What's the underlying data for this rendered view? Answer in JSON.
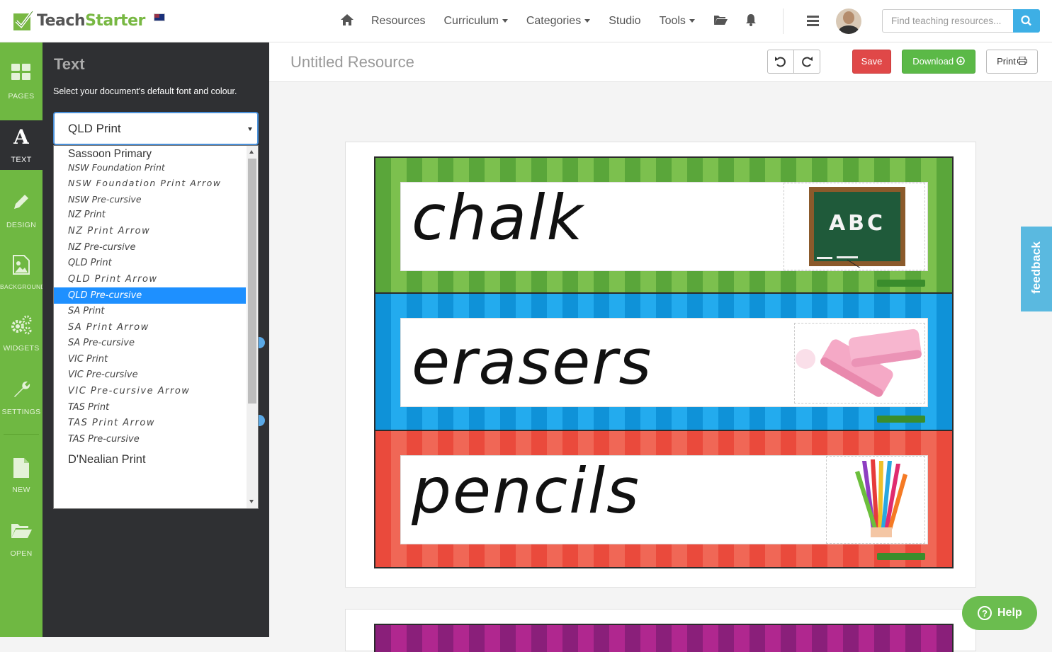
{
  "header": {
    "brand_part1": "Teach",
    "brand_part2": "Starter",
    "nav": [
      {
        "label": "Resources",
        "dropdown": false
      },
      {
        "label": "Curriculum",
        "dropdown": true
      },
      {
        "label": "Categories",
        "dropdown": true
      },
      {
        "label": "Studio",
        "dropdown": false
      },
      {
        "label": "Tools",
        "dropdown": true
      }
    ],
    "search_placeholder": "Find teaching resources..."
  },
  "sidebar": {
    "items": [
      {
        "label": "PAGES",
        "icon": "grid-icon"
      },
      {
        "label": "TEXT",
        "icon": "font-a-icon",
        "active": true
      },
      {
        "label": "DESIGN",
        "icon": "pencil-icon"
      },
      {
        "label": "BACKGROUND",
        "icon": "image-icon"
      },
      {
        "label": "WIDGETS",
        "icon": "gears-icon"
      },
      {
        "label": "SETTINGS",
        "icon": "wrench-icon"
      },
      {
        "label": "NEW",
        "icon": "file-icon"
      },
      {
        "label": "OPEN",
        "icon": "folder-open-icon"
      }
    ]
  },
  "panel": {
    "title": "Text",
    "hint": "Select your document's default font and colour.",
    "selected_font": "QLD Print",
    "options": [
      "Sassoon Primary",
      "NSW Foundation Print",
      "NSW Foundation Print Arrow",
      "NSW Pre-cursive",
      "NZ Print",
      "NZ Print Arrow",
      "NZ Pre-cursive",
      "QLD Print",
      "QLD Print Arrow",
      "QLD Pre-cursive",
      "SA Print",
      "SA Print Arrow",
      "SA Pre-cursive",
      "VIC Print",
      "VIC Pre-cursive",
      "VIC Pre-cursive Arrow",
      "TAS Print",
      "TAS Print Arrow",
      "TAS Pre-cursive",
      "D'Nealian Print"
    ],
    "highlighted_option": "QLD Pre-cursive"
  },
  "editor": {
    "doc_title": "Untitled Resource",
    "save_label": "Save",
    "download_label": "Download",
    "print_label": "Print",
    "cards": [
      {
        "word": "chalk",
        "color": "#6cb33f",
        "image": "chalkboard-abc"
      },
      {
        "word": "erasers",
        "color": "#1aa3e0",
        "image": "pink-erasers"
      },
      {
        "word": "pencils",
        "color": "#ee5a48",
        "image": "colored-pencils"
      }
    ],
    "chalkboard_text": "ABC",
    "watermark": "TeachStarter.com"
  },
  "feedback_label": "feedback",
  "help_label": "Help",
  "colors": {
    "brand_green": "#6fb842",
    "panel_dark": "#2f3033",
    "save_red": "#e04848",
    "download_green": "#5bb947",
    "search_blue": "#3dafe5",
    "selection_blue": "#1e90ff"
  }
}
